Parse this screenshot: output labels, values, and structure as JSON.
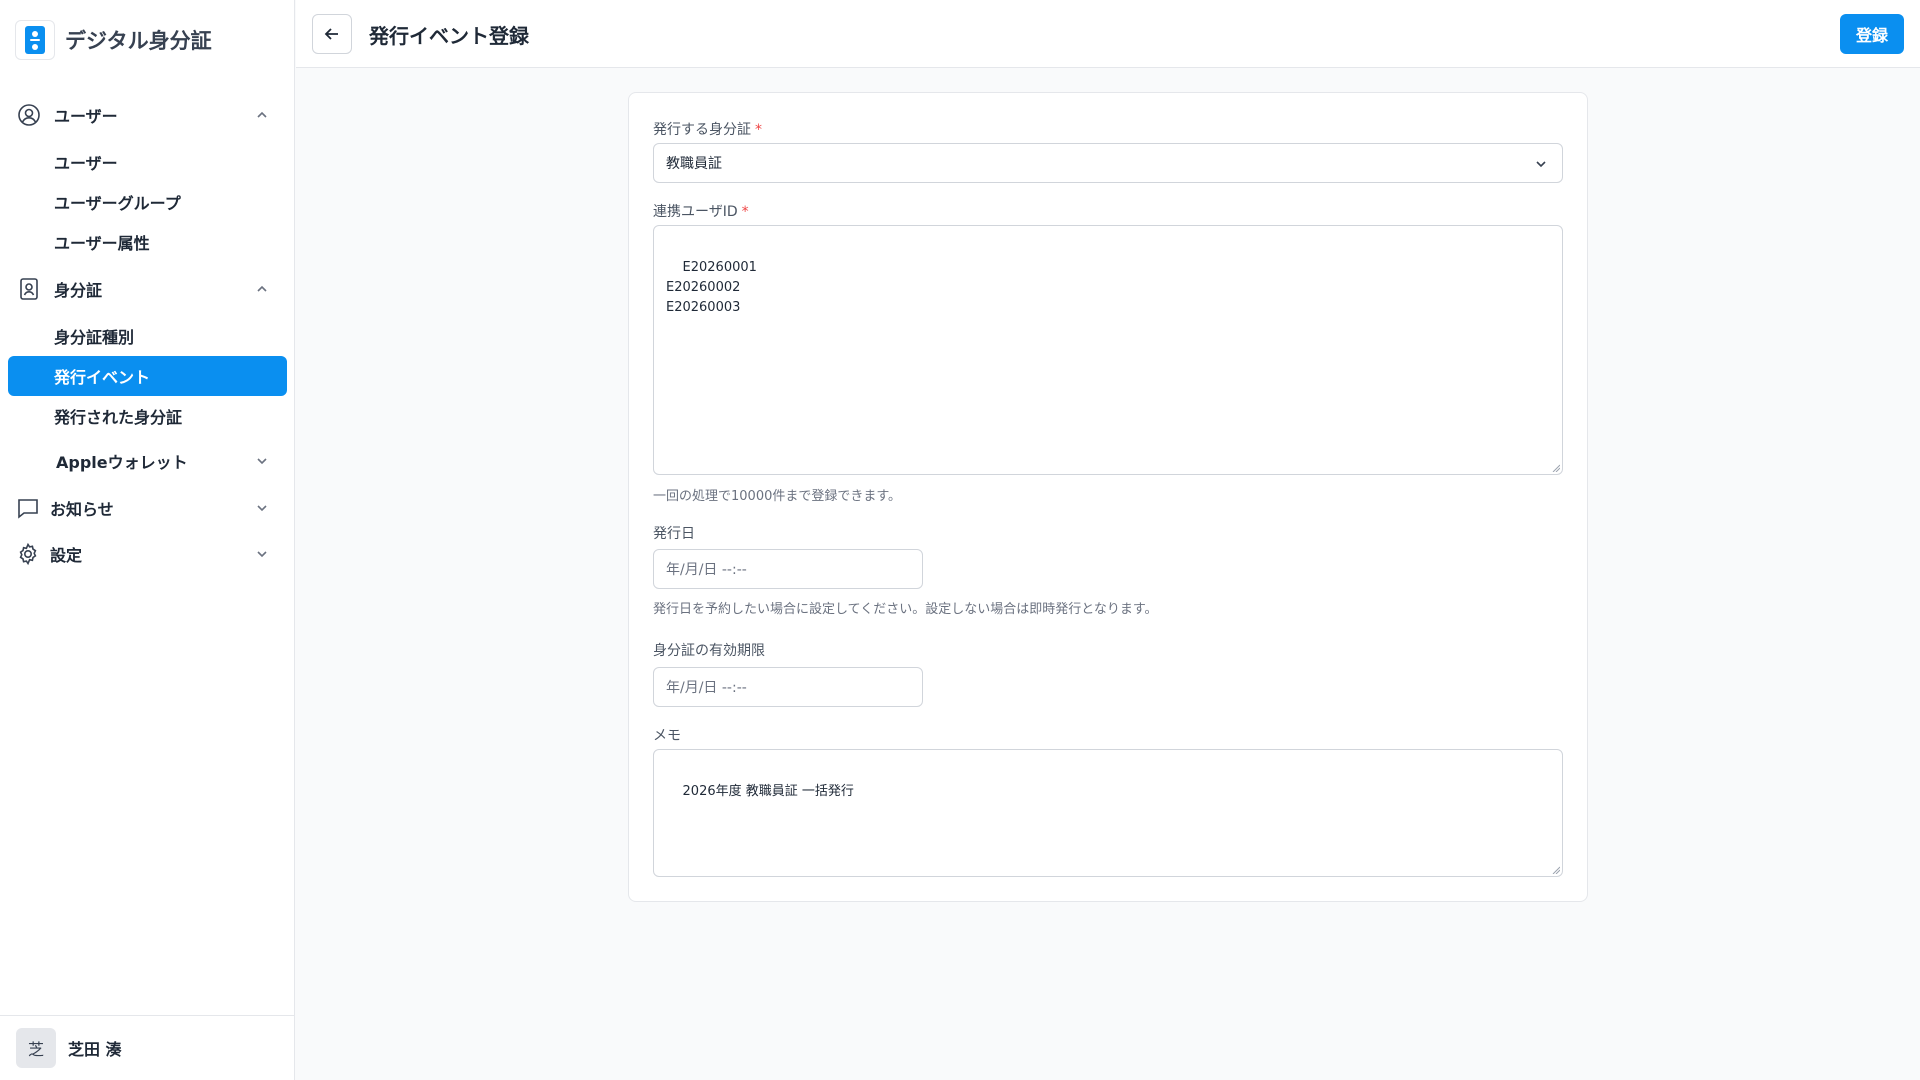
{
  "app": {
    "title": "デジタル身分証"
  },
  "sidebar": {
    "groups": [
      {
        "label": "ユーザー",
        "items": [
          "ユーザー",
          "ユーザーグループ",
          "ユーザー属性"
        ]
      },
      {
        "label": "身分証",
        "items": [
          "身分証種別",
          "発行イベント",
          "発行された身分証",
          "Appleウォレット"
        ]
      },
      {
        "label": "お知らせ"
      },
      {
        "label": "設定"
      }
    ],
    "active_item": "発行イベント"
  },
  "user": {
    "avatar_char": "芝",
    "name": "芝田 湊"
  },
  "header": {
    "title": "発行イベント登録",
    "register_label": "登録"
  },
  "form": {
    "id_type": {
      "label": "発行する身分証",
      "required_mark": "*",
      "value": "教職員証"
    },
    "user_ids": {
      "label": "連携ユーザID",
      "required_mark": "*",
      "value": "E20260001\nE20260002\nE20260003",
      "hint": "一回の処理で10000件まで登録できます。"
    },
    "issue_date": {
      "label": "発行日",
      "placeholder": "年/月/日 --:--",
      "hint": "発行日を予約したい場合に設定してください。設定しない場合は即時発行となります。"
    },
    "expiry_date": {
      "label": "身分証の有効期限",
      "placeholder": "年/月/日 --:--"
    },
    "memo": {
      "label": "メモ",
      "value": "2026年度 教職員証 一括発行"
    }
  },
  "colors": {
    "accent": "#0a8ff0",
    "required": "#ef4444"
  }
}
